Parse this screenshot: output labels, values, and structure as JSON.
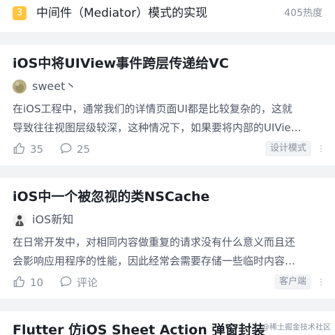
{
  "ranking": {
    "rank": "3",
    "title": "中间件（Mediator）模式的实现",
    "heat": "405热度"
  },
  "articles": [
    {
      "title": "iOS中将UIView事件跨层传递给VC",
      "author": "sweet丶",
      "excerpt_lines": [
        "在iOS工程中，通常我们的详情页面UI都是比较复杂的，这就",
        "导致往往视图层级较深，这种情况下，如果要将内部的UIVie…"
      ],
      "likes": "35",
      "comments": "25",
      "tag": "设计模式"
    },
    {
      "title": "iOS中一个被忽视的类NSCache",
      "author": "iOS新知",
      "excerpt_lines": [
        "在日常开发中，对相同内容做重复的请求没有什么意义而且还",
        "会影响应用程序的性能，因此经常会需要存储一些临时内容…"
      ],
      "likes": "10",
      "comments": "评论",
      "tag": "客户端"
    },
    {
      "title": "Flutter 仿iOS Sheet Action 弹窗封装"
    }
  ],
  "watermark": "@稀土掘金技术社区",
  "colors": {
    "rank_badge": "#ffc53d",
    "text_primary": "#1d2129",
    "text_secondary": "#515767",
    "text_muted": "#8a919f",
    "page_background": "#f2f3f5"
  },
  "icons": {
    "like": "thumbs-up-icon",
    "comment": "comment-bubble-icon",
    "more": "more-vertical-icon"
  }
}
